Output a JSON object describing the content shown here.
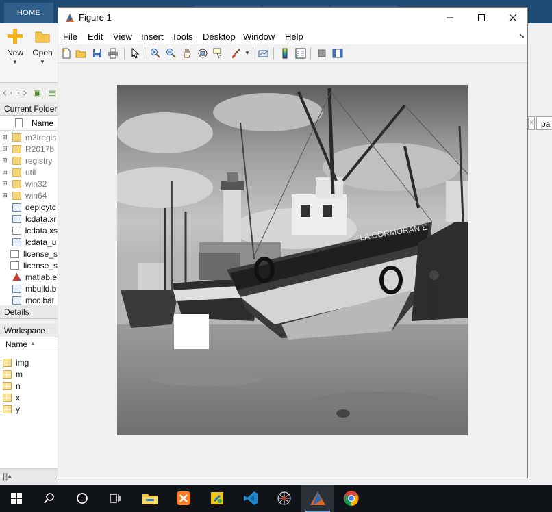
{
  "ribbon": {
    "home_tab": "HOME",
    "new_label": "New",
    "open_label": "Open"
  },
  "current_folder": {
    "title": "Current Folder",
    "column_name": "Name",
    "items": [
      {
        "name": "m3iregis",
        "type": "folder",
        "dim": true,
        "expandable": true
      },
      {
        "name": "R2017b",
        "type": "folder",
        "dim": true,
        "expandable": true
      },
      {
        "name": "registry",
        "type": "folder",
        "dim": true,
        "expandable": true
      },
      {
        "name": "util",
        "type": "folder",
        "dim": true,
        "expandable": true
      },
      {
        "name": "win32",
        "type": "folder",
        "dim": true,
        "expandable": true
      },
      {
        "name": "win64",
        "type": "folder",
        "dim": true,
        "expandable": true
      },
      {
        "name": "deploytc",
        "type": "mfile",
        "dim": false,
        "expandable": false
      },
      {
        "name": "lcdata.xr",
        "type": "mfile",
        "dim": false,
        "expandable": false
      },
      {
        "name": "lcdata.xs",
        "type": "file",
        "dim": false,
        "expandable": false
      },
      {
        "name": "lcdata_u",
        "type": "mfile",
        "dim": false,
        "expandable": false
      },
      {
        "name": "license_s",
        "type": "file",
        "dim": false,
        "expandable": false
      },
      {
        "name": "license_s",
        "type": "file",
        "dim": false,
        "expandable": false
      },
      {
        "name": "matlab.e",
        "type": "logo",
        "dim": false,
        "expandable": false
      },
      {
        "name": "mbuild.b",
        "type": "mfile",
        "dim": false,
        "expandable": false
      },
      {
        "name": "mcc.bat",
        "type": "mfile",
        "dim": false,
        "expandable": false
      }
    ]
  },
  "details": {
    "title": "Details"
  },
  "workspace": {
    "title": "Workspace",
    "column_name": "Name",
    "variables": [
      "img",
      "m",
      "n",
      "x",
      "y"
    ]
  },
  "editor_tab": {
    "label": "pa"
  },
  "figure": {
    "title": "Figure 1",
    "menu": [
      "File",
      "Edit",
      "View",
      "Insert",
      "Tools",
      "Desktop",
      "Window",
      "Help"
    ],
    "toolbar_icons": [
      "new-figure-icon",
      "open-file-icon",
      "save-icon",
      "print-icon",
      "select-arrow-icon",
      "zoom-in-icon",
      "zoom-out-icon",
      "pan-hand-icon",
      "rotate-3d-icon",
      "data-cursor-icon",
      "brush-icon",
      "link-plot-icon",
      "colorbar-icon",
      "legend-icon",
      "hide-plot-tools-icon",
      "show-plot-tools-icon"
    ],
    "image_alt": "grayscale photo of fishing boats on a beach with a lighthouse, white square block in lower left",
    "ship_text": "LA CORMORAN E"
  },
  "taskbar": {
    "icons": [
      "windows-start-icon",
      "search-icon",
      "cortana-icon",
      "task-view-icon",
      "file-explorer-icon",
      "xampp-icon",
      "vector-app-icon",
      "vscode-icon",
      "network-app-icon",
      "matlab-icon",
      "chrome-icon"
    ]
  }
}
